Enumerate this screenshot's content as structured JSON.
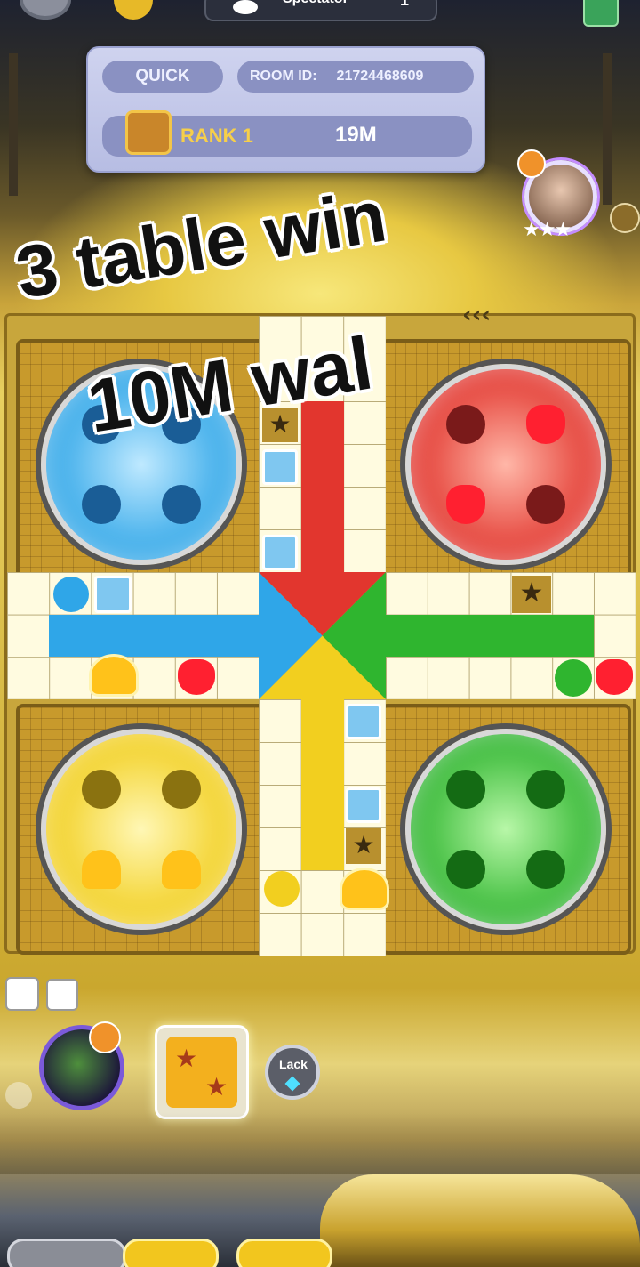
{
  "header": {
    "spectator_label": "Spectator",
    "spectator_count": "1"
  },
  "room": {
    "mode": "QUICK",
    "room_id_label": "ROOM ID:",
    "room_id": "21724468609",
    "rank_label": "RANK 1",
    "prize": "19M"
  },
  "overlay": {
    "line1": "3 table win",
    "line2": "10M wal"
  },
  "controls": {
    "lock_label": "Lack"
  },
  "colors": {
    "blue": "#2fa6e8",
    "red": "#e2362e",
    "green": "#2fb52f",
    "yellow": "#f2cf1f",
    "gold": "#d9b43a",
    "track": "#fffbe0"
  }
}
